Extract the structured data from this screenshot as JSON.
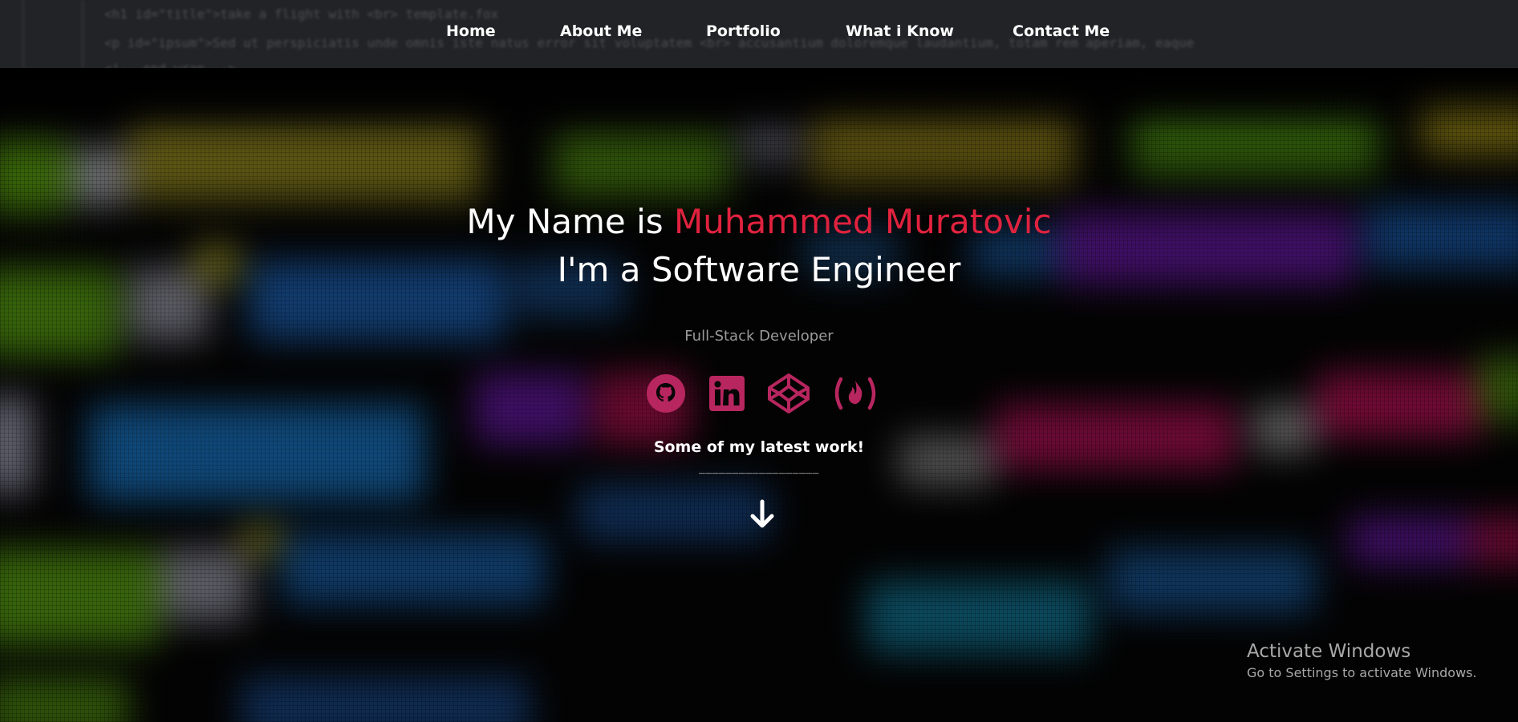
{
  "nav": {
    "items": [
      {
        "label": "Home"
      },
      {
        "label": "About Me"
      },
      {
        "label": "Portfolio"
      },
      {
        "label": "What i Know"
      },
      {
        "label": "Contact Me"
      }
    ]
  },
  "hero": {
    "greeting": "My Name is ",
    "name": "Muhammed Muratovic",
    "role_line": "I'm a Software Engineer",
    "tagline": "Full-Stack Developer",
    "latest_work": "Some of my latest work!",
    "underline": "__________________",
    "socials": [
      {
        "icon": "github-icon"
      },
      {
        "icon": "linkedin-icon"
      },
      {
        "icon": "codepen-icon"
      },
      {
        "icon": "freecodecamp-icon"
      }
    ]
  },
  "watermark": {
    "title": "Activate Windows",
    "subtitle": "Go to Settings to activate Windows."
  },
  "colors": {
    "accent": "#e0223e",
    "icon": "#b8265f",
    "nav_bg": "#222326"
  }
}
